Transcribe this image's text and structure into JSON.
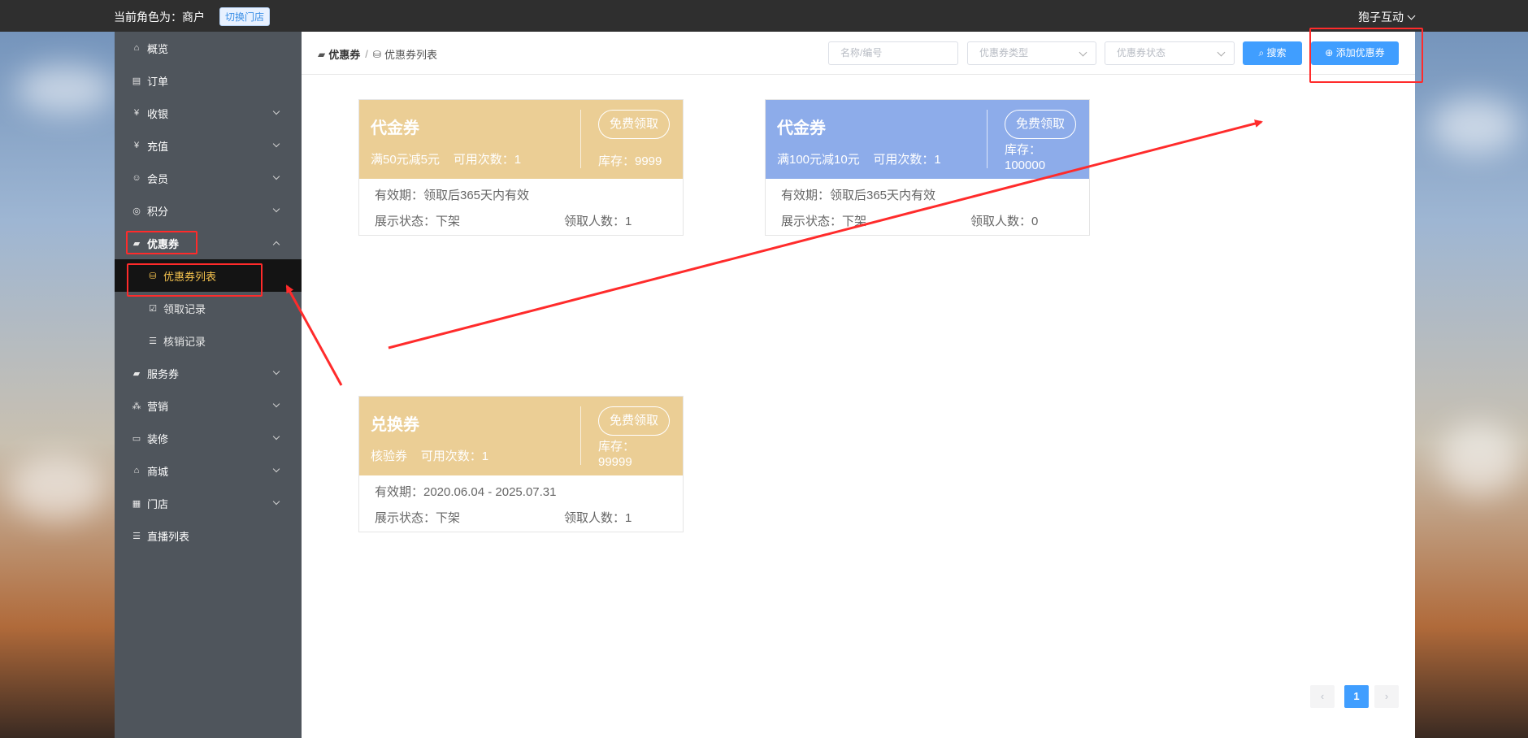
{
  "topbar": {
    "role_text": "当前角色为：商户",
    "switch_store": "切换门店",
    "user_name": "狍子互动"
  },
  "sidebar": {
    "items": [
      {
        "label": "概览",
        "icon": "home-icon",
        "arrow": false
      },
      {
        "label": "订单",
        "icon": "order-icon",
        "arrow": false
      },
      {
        "label": "收银",
        "icon": "yen-icon",
        "arrow": true
      },
      {
        "label": "充值",
        "icon": "yen-icon",
        "arrow": true
      },
      {
        "label": "会员",
        "icon": "member-icon",
        "arrow": true
      },
      {
        "label": "积分",
        "icon": "points-icon",
        "arrow": true
      },
      {
        "label": "优惠券",
        "icon": "coupon-icon",
        "arrow": true,
        "expanded": true
      },
      {
        "label": "服务券",
        "icon": "ticket-icon",
        "arrow": true
      },
      {
        "label": "营销",
        "icon": "marketing-icon",
        "arrow": true
      },
      {
        "label": "装修",
        "icon": "decorate-icon",
        "arrow": true
      },
      {
        "label": "商城",
        "icon": "mall-icon",
        "arrow": true
      },
      {
        "label": "门店",
        "icon": "store-icon",
        "arrow": true
      },
      {
        "label": "直播列表",
        "icon": "list-icon",
        "arrow": false
      }
    ],
    "coupon_sub": [
      {
        "label": "优惠券列表",
        "icon": "coupon-list-icon",
        "active": true
      },
      {
        "label": "领取记录",
        "icon": "check-icon",
        "active": false
      },
      {
        "label": "核销记录",
        "icon": "list-icon",
        "active": false
      }
    ]
  },
  "breadcrumb": {
    "root": "优惠券",
    "current": "优惠券列表"
  },
  "toolbar": {
    "name_placeholder": "名称/编号",
    "type_placeholder": "优惠券类型",
    "status_placeholder": "优惠券状态",
    "search_label": "搜索",
    "add_label": "添加优惠券"
  },
  "coupons": [
    {
      "title": "代金券",
      "condition": "满50元减5元",
      "uses": "可用次数：1",
      "claim": "免费领取",
      "stock": "库存：9999",
      "validity": "有效期：领取后365天内有效",
      "display_status": "展示状态：下架",
      "claimed": "领取人数：1",
      "color": "#ebce95"
    },
    {
      "title": "代金券",
      "condition": "满100元减10元",
      "uses": "可用次数：1",
      "claim": "免费领取",
      "stock": "库存：100000",
      "validity": "有效期：领取后365天内有效",
      "display_status": "展示状态：下架",
      "claimed": "领取人数：0",
      "color": "#8dacea"
    },
    {
      "title": "兑换券",
      "condition": "核验券",
      "uses": "可用次数：1",
      "claim": "免费领取",
      "stock": "库存：99999",
      "validity": "有效期：2020.06.04 - 2025.07.31",
      "display_status": "展示状态：下架",
      "claimed": "领取人数：1",
      "color": "#ebce95"
    }
  ],
  "pagination": {
    "current": "1",
    "prev": "‹",
    "next": "›"
  },
  "colors": {
    "primary": "#409eff",
    "sidebar_bg": "#4f555c",
    "active_text": "#f4c24e",
    "annotation_red": "#ff2b2b"
  }
}
